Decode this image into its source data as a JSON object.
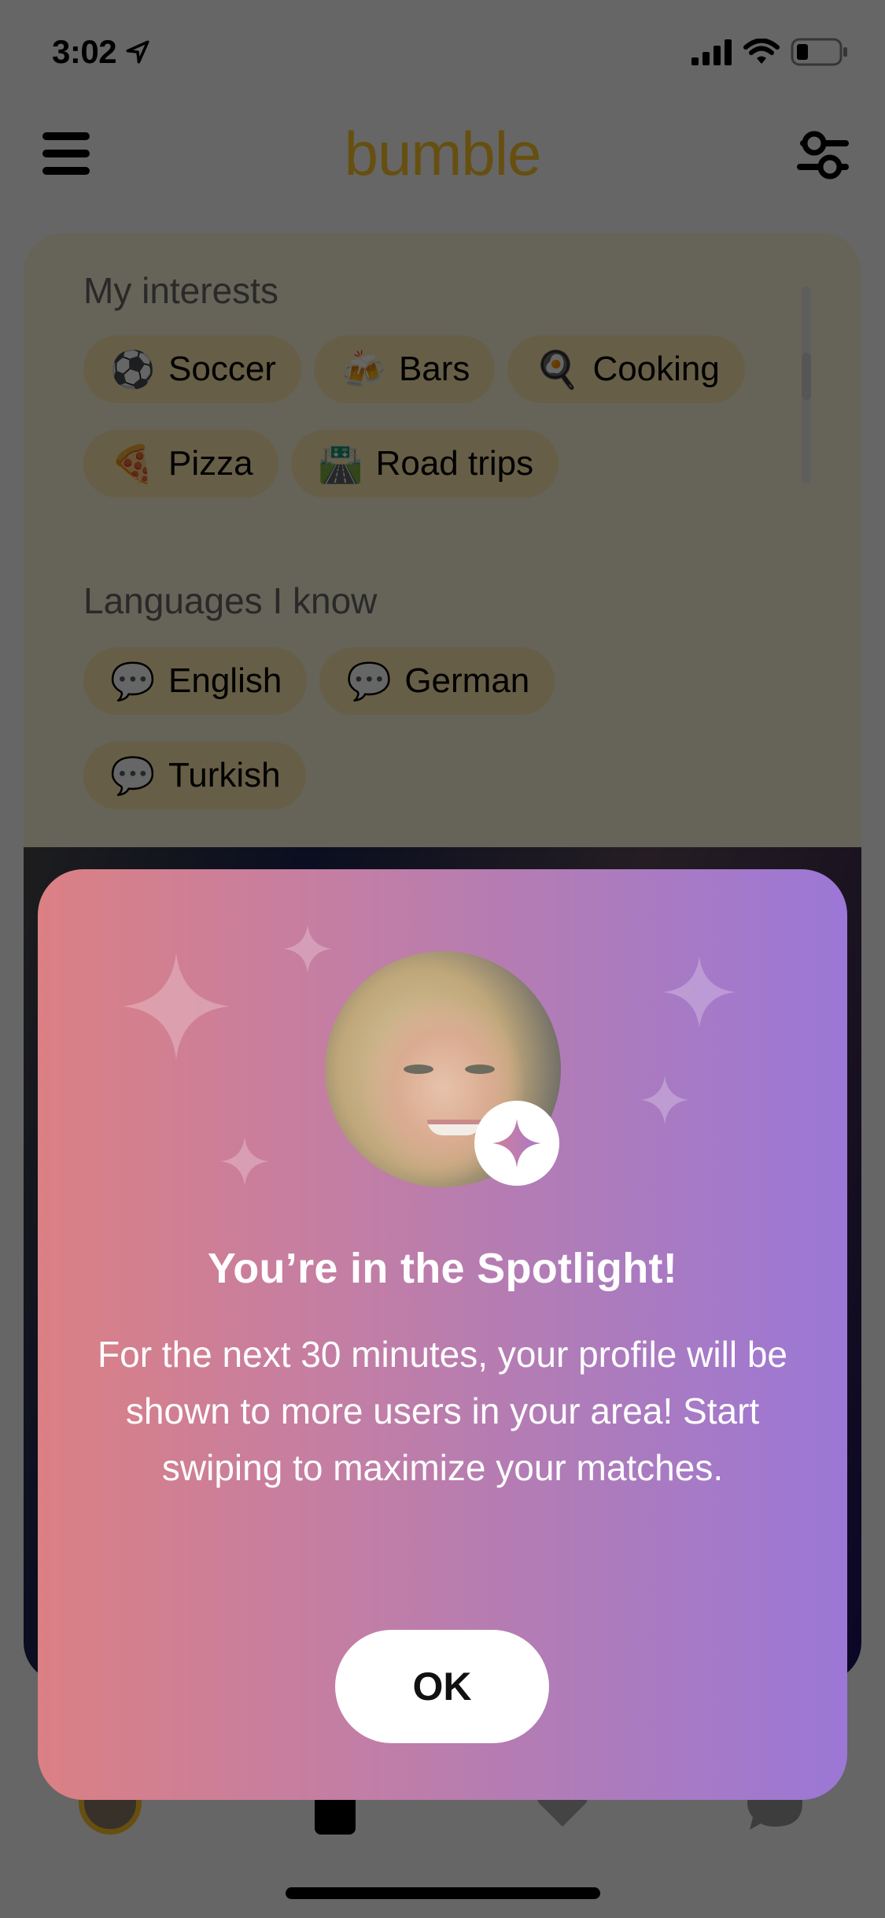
{
  "status_bar": {
    "time": "3:02",
    "location_icon": "location-arrow-icon",
    "signal_icon": "cellular-signal-icon",
    "wifi_icon": "wifi-icon",
    "battery_icon": "battery-low-icon"
  },
  "header": {
    "logo_text": "bumble",
    "menu_icon": "hamburger-menu-icon",
    "filter_icon": "filter-sliders-icon",
    "brand_color": "#FFC629"
  },
  "profile": {
    "interests_title": "My interests",
    "interests": [
      {
        "emoji": "⚽",
        "label": "Soccer"
      },
      {
        "emoji": "🍻",
        "label": "Bars"
      },
      {
        "emoji": "🍳",
        "label": "Cooking"
      },
      {
        "emoji": "🍕",
        "label": "Pizza"
      },
      {
        "emoji": "🛣️",
        "label": "Road trips"
      }
    ],
    "languages_title": "Languages I know",
    "languages": [
      {
        "emoji": "💬",
        "label": "English"
      },
      {
        "emoji": "💬",
        "label": "German"
      },
      {
        "emoji": "💬",
        "label": "Turkish"
      }
    ]
  },
  "bottom_nav": {
    "items": [
      "profile-avatar",
      "swipe-cards",
      "likes-heart",
      "chats"
    ]
  },
  "modal": {
    "title": "You’re in the Spotlight!",
    "body": "For the next 30 minutes, your profile will be shown to more users in your area! Start swiping to maximize your matches.",
    "ok_label": "OK",
    "avatar_icon": "user-photo",
    "badge_icon": "sparkle-icon",
    "gradient_start": "#DB8084",
    "gradient_end": "#9B77D6"
  }
}
